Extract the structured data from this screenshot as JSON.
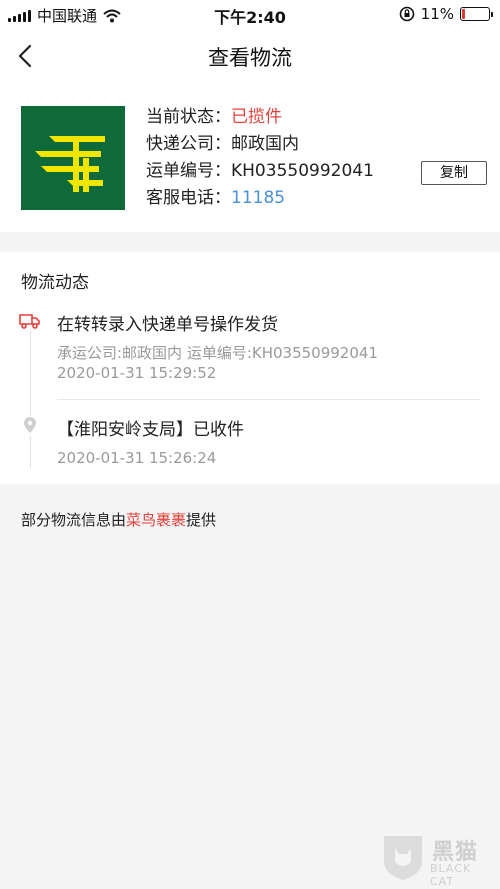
{
  "status_bar": {
    "carrier": "中国联通",
    "time": "下午2:40",
    "battery_percent": "11%",
    "battery_level": 0.11
  },
  "nav": {
    "title": "查看物流"
  },
  "info": {
    "status_label": "当前状态：",
    "status_value": "已揽件",
    "company_label": "快递公司：",
    "company_value": "邮政国内",
    "tracking_label": "运单编号：",
    "tracking_value": "KH03550992041",
    "phone_label": "客服电话：",
    "phone_value": "11185",
    "copy_button": "复制"
  },
  "tracking": {
    "heading": "物流动态",
    "events": [
      {
        "title": "在转转录入快递单号操作发货",
        "detail": "承运公司:邮政国内 运单编号:KH03550992041",
        "time": "2020-01-31 15:29:52"
      },
      {
        "title": "【淮阳安岭支局】已收件",
        "time": "2020-01-31 15:26:24"
      }
    ]
  },
  "footer": {
    "prefix": "部分物流信息由",
    "link": "菜鸟裹裹",
    "suffix": "提供"
  },
  "watermark": {
    "cn": "黑猫",
    "en": "BLACK CAT"
  },
  "colors": {
    "accent_red": "#e5403a",
    "link_blue": "#4a90d9",
    "logo_green": "#0e6b39",
    "logo_yellow": "#f2e600"
  }
}
